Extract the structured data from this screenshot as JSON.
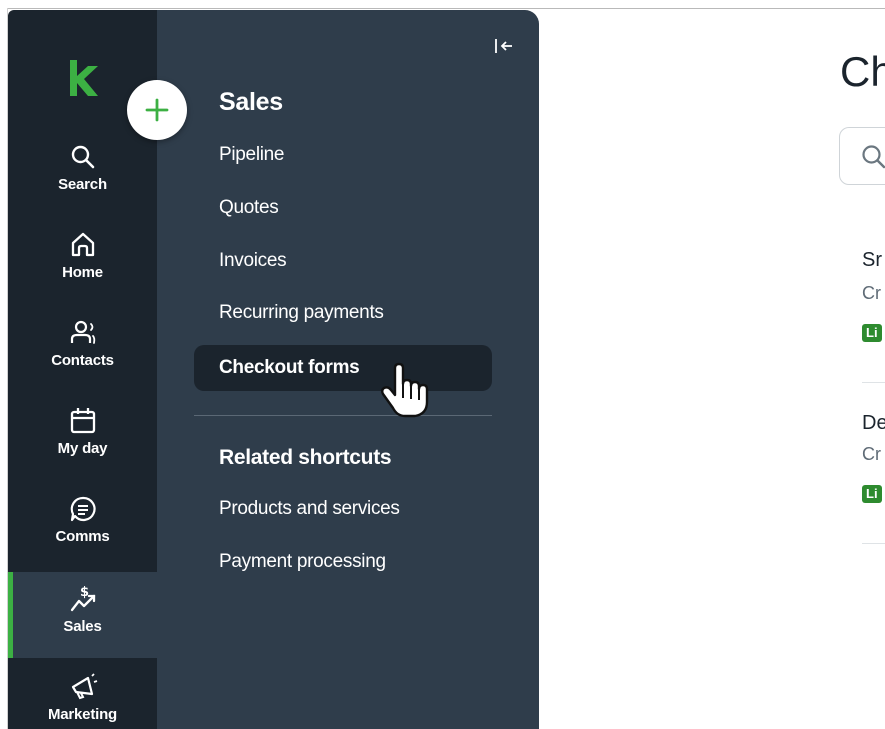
{
  "app": {
    "accent": "#3cb043",
    "rail_bg": "#1b242d",
    "flyout_bg": "#2f3d4b"
  },
  "rail": {
    "items": [
      {
        "label": "Search",
        "icon": "search-icon"
      },
      {
        "label": "Home",
        "icon": "home-icon"
      },
      {
        "label": "Contacts",
        "icon": "contacts-icon"
      },
      {
        "label": "My day",
        "icon": "calendar-icon"
      },
      {
        "label": "Comms",
        "icon": "chat-icon"
      },
      {
        "label": "Sales",
        "icon": "sales-icon",
        "active": true
      },
      {
        "label": "Marketing",
        "icon": "megaphone-icon"
      }
    ]
  },
  "flyout": {
    "section_title": "Sales",
    "items": [
      {
        "label": "Pipeline"
      },
      {
        "label": "Quotes"
      },
      {
        "label": "Invoices"
      },
      {
        "label": "Recurring payments"
      },
      {
        "label": "Checkout forms",
        "active": true
      }
    ],
    "related_title": "Related shortcuts",
    "related_items": [
      {
        "label": "Products and services"
      },
      {
        "label": "Payment processing"
      }
    ]
  },
  "main": {
    "title": "Ch",
    "rows": [
      {
        "title": "Sr",
        "sub": "Cr",
        "badge": "Li"
      },
      {
        "title": "De",
        "sub": "Cr",
        "badge": "Li"
      }
    ]
  }
}
